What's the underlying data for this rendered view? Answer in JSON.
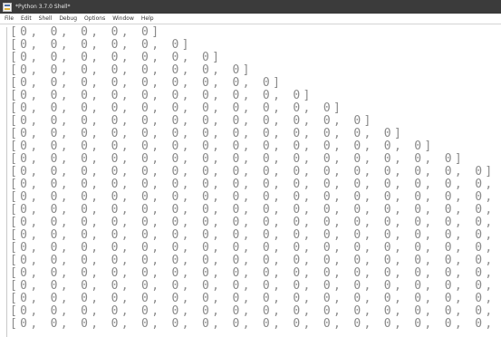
{
  "window": {
    "title": "*Python 3.7.0 Shell*",
    "icon": "python-idle-icon"
  },
  "menu": [
    "File",
    "Edit",
    "Shell",
    "Debug",
    "Options",
    "Window",
    "Help"
  ],
  "shell": {
    "output_lines": [
      "[0, 0, 0, 0, 0]",
      "[0, 0, 0, 0, 0, 0]",
      "[0, 0, 0, 0, 0, 0, 0]",
      "[0, 0, 0, 0, 0, 0, 0, 0]",
      "[0, 0, 0, 0, 0, 0, 0, 0, 0]",
      "[0, 0, 0, 0, 0, 0, 0, 0, 0, 0]",
      "[0, 0, 0, 0, 0, 0, 0, 0, 0, 0, 0]",
      "[0, 0, 0, 0, 0, 0, 0, 0, 0, 0, 0, 0]",
      "[0, 0, 0, 0, 0, 0, 0, 0, 0, 0, 0, 0, 0]",
      "[0, 0, 0, 0, 0, 0, 0, 0, 0, 0, 0, 0, 0, 0]",
      "[0, 0, 0, 0, 0, 0, 0, 0, 0, 0, 0, 0, 0, 0, 0]",
      "[0, 0, 0, 0, 0, 0, 0, 0, 0, 0, 0, 0, 0, 0, 0, 0]",
      "[0, 0, 0, 0, 0, 0, 0, 0, 0, 0, 0, 0, 0, 0, 0, 0, 0]",
      "[0, 0, 0, 0, 0, 0, 0, 0, 0, 0, 0, 0, 0, 0, 0, 0, 0, 0]",
      "[0, 0, 0, 0, 0, 0, 0, 0, 0, 0, 0, 0, 0, 0, 0, 0, 0, 0,",
      "[0, 0, 0, 0, 0, 0, 0, 0, 0, 0, 0, 0, 0, 0, 0, 0, 0, 0,",
      "[0, 0, 0, 0, 0, 0, 0, 0, 0, 0, 0, 0, 0, 0, 0, 0, 0, 0,",
      "[0, 0, 0, 0, 0, 0, 0, 0, 0, 0, 0, 0, 0, 0, 0, 0, 0, 0,",
      "[0, 0, 0, 0, 0, 0, 0, 0, 0, 0, 0, 0, 0, 0, 0, 0, 0, 0,",
      "[0, 0, 0, 0, 0, 0, 0, 0, 0, 0, 0, 0, 0, 0, 0, 0, 0, 0,",
      "[0, 0, 0, 0, 0, 0, 0, 0, 0, 0, 0, 0, 0, 0, 0, 0, 0, 0,",
      "[0, 0, 0, 0, 0, 0, 0, 0, 0, 0, 0, 0, 0, 0, 0, 0, 0, 0,",
      "[0, 0, 0, 0, 0, 0, 0, 0, 0, 0, 0, 0, 0, 0, 0, 0, 0, 0,",
      "[0, 0, 0, 0, 0, 0, 0, 0, 0, 0, 0, 0, 0, 0, 0, 0, 0, 0,"
    ]
  },
  "colors": {
    "titlebar": "#3b3b3b",
    "title_text": "#e8e8e8",
    "menubar": "#ffffff",
    "menu_text": "#333333",
    "shell_background": "#ffffff",
    "output_text": "#8a8a8a"
  }
}
